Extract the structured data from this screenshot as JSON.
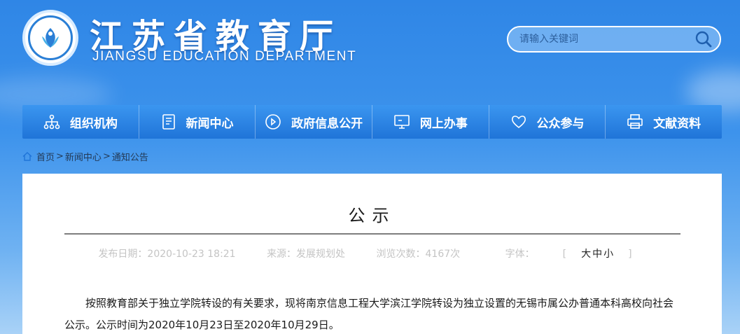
{
  "header": {
    "title": "江苏省教育厅",
    "subtitle": "JIANGSU EDUCATION DEPARTMENT",
    "search_placeholder": "请输入关键词"
  },
  "nav": {
    "items": [
      {
        "label": "组织机构",
        "icon": "org-chart-icon"
      },
      {
        "label": "新闻中心",
        "icon": "document-icon"
      },
      {
        "label": "政府信息公开",
        "icon": "play-circle-icon"
      },
      {
        "label": "网上办事",
        "icon": "monitor-icon"
      },
      {
        "label": "公众参与",
        "icon": "heart-icon"
      },
      {
        "label": "文献资料",
        "icon": "printer-icon"
      }
    ]
  },
  "breadcrumb": {
    "home": "首页",
    "sep1": ">",
    "news": "新闻中心",
    "sep2": ">",
    "current": "通知公告"
  },
  "article": {
    "title": "公示",
    "publish_date": "发布日期：2020-10-23 18:21",
    "source": "来源：发展规划处",
    "views": "浏览次数：4167次",
    "font_label": "字体：",
    "font_open": "[",
    "font_large": "大",
    "font_medium": "中",
    "font_small": "小",
    "font_close": "]",
    "body": "按照教育部关于独立学院转设的有关要求，现将南京信息工程大学滨江学院转设为独立设置的无锡市属公办普通本科高校向社会公示。公示时间为2020年10月23日至2020年10月29日。"
  },
  "colors": {
    "nav_top": "#3b96f0",
    "nav_bottom": "#1f74d8",
    "page_bg": "#3d93ec",
    "meta_text": "#c4c4c4"
  }
}
